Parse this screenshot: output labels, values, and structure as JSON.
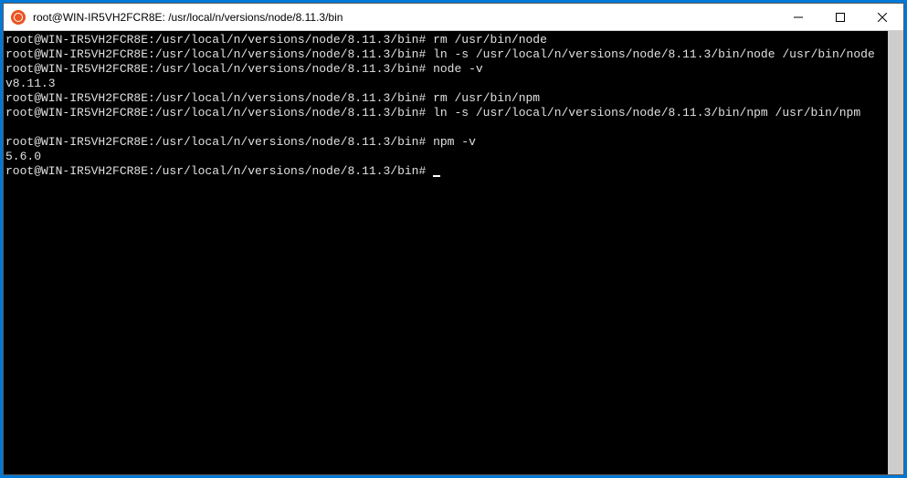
{
  "titlebar": {
    "title": "root@WIN-IR5VH2FCR8E: /usr/local/n/versions/node/8.11.3/bin"
  },
  "terminal": {
    "prompt": "root@WIN-IR5VH2FCR8E:/usr/local/n/versions/node/8.11.3/bin#",
    "lines": [
      {
        "prompt": true,
        "cmd": "rm /usr/bin/node"
      },
      {
        "prompt": true,
        "cmd": "ln -s /usr/local/n/versions/node/8.11.3/bin/node /usr/bin/node"
      },
      {
        "prompt": true,
        "cmd": "node -v"
      },
      {
        "out": "v8.11.3"
      },
      {
        "prompt": true,
        "cmd": "rm /usr/bin/npm"
      },
      {
        "prompt": true,
        "cmd": "ln -s /usr/local/n/versions/node/8.11.3/bin/npm /usr/bin/npm"
      },
      {
        "out": ""
      },
      {
        "prompt": true,
        "cmd": "npm -v"
      },
      {
        "out": "5.6.0"
      },
      {
        "prompt": true,
        "cmd": "",
        "cursor": true
      }
    ]
  }
}
